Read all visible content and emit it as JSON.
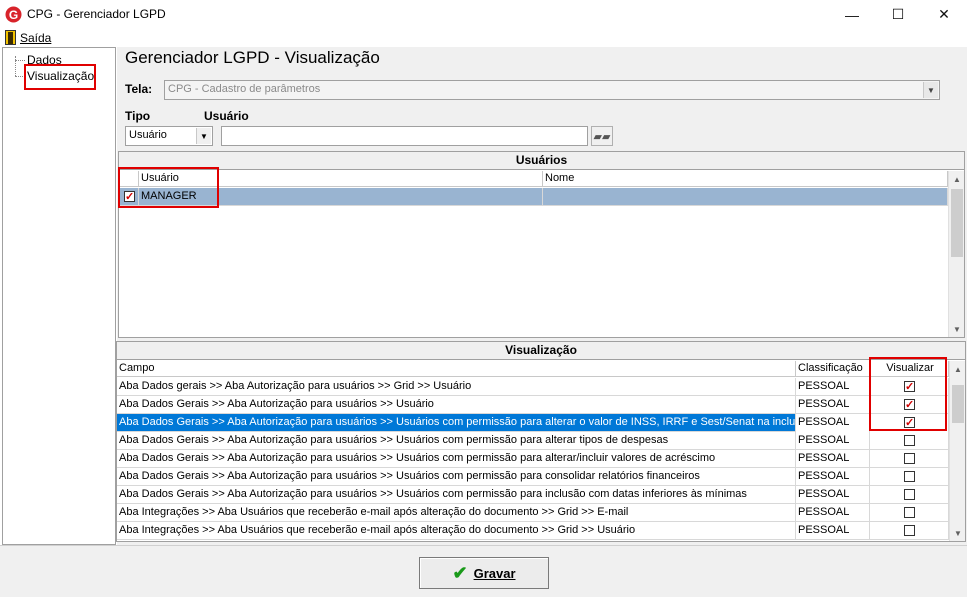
{
  "window": {
    "title": "CPG - Gerenciador LGPD",
    "logo_letter": "G",
    "min_glyph": "—",
    "max_glyph": "☐",
    "close_glyph": "✕"
  },
  "menu": {
    "exit_label": "Saída"
  },
  "tree": {
    "items": [
      {
        "label": "Dados"
      },
      {
        "label": "Visualização"
      }
    ]
  },
  "main": {
    "heading": "Gerenciador LGPD - Visualização",
    "tela_label": "Tela:",
    "tela_value": "CPG - Cadastro de parâmetros",
    "tipo_label": "Tipo",
    "usuario_label": "Usuário",
    "tipo_value": "Usuário",
    "usuario_value": ""
  },
  "users_panel": {
    "title": "Usuários",
    "columns": [
      "Usuário",
      "Nome"
    ],
    "rows": [
      {
        "checked": true,
        "usuario": "MANAGER",
        "nome": ""
      }
    ]
  },
  "view_panel": {
    "title": "Visualização",
    "columns": [
      "Campo",
      "Classificação",
      "Visualizar"
    ],
    "rows": [
      {
        "campo": "Aba Dados gerais >> Aba Autorização para usuários >> Grid >> Usuário",
        "classificacao": "PESSOAL",
        "visualizar": true,
        "selected": false
      },
      {
        "campo": "Aba Dados Gerais >> Aba Autorização para usuários >> Usuário",
        "classificacao": "PESSOAL",
        "visualizar": true,
        "selected": false
      },
      {
        "campo": "Aba Dados Gerais >> Aba Autorização para usuários >> Usuários com permissão para alterar o valor de INSS, IRRF e Sest/Senat na inclusão",
        "classificacao": "PESSOAL",
        "visualizar": true,
        "selected": true
      },
      {
        "campo": "Aba Dados Gerais >> Aba Autorização para usuários >> Usuários com permissão para alterar tipos de despesas",
        "classificacao": "PESSOAL",
        "visualizar": false,
        "selected": false
      },
      {
        "campo": "Aba Dados Gerais >> Aba Autorização para usuários >> Usuários com permissão para alterar/incluir valores de acréscimo",
        "classificacao": "PESSOAL",
        "visualizar": false,
        "selected": false
      },
      {
        "campo": "Aba Dados Gerais >> Aba Autorização para usuários >> Usuários com permissão para consolidar relatórios financeiros",
        "classificacao": "PESSOAL",
        "visualizar": false,
        "selected": false
      },
      {
        "campo": "Aba Dados Gerais >> Aba Autorização para usuários >> Usuários com permissão para inclusão com datas inferiores às mínimas",
        "classificacao": "PESSOAL",
        "visualizar": false,
        "selected": false
      },
      {
        "campo": "Aba Integrações  >> Aba Usuários que receberão e-mail após alteração do documento >> Grid >> E-mail",
        "classificacao": "PESSOAL",
        "visualizar": false,
        "selected": false
      },
      {
        "campo": "Aba Integrações  >> Aba Usuários que receberão e-mail após alteração do documento >> Grid >> Usuário",
        "classificacao": "PESSOAL",
        "visualizar": false,
        "selected": false
      }
    ]
  },
  "footer": {
    "save_label": "Gravar"
  },
  "colors": {
    "selection": "#0078d7",
    "highlight_border": "#e00000",
    "check": "#d00000",
    "save_check": "#1a9a1a"
  }
}
